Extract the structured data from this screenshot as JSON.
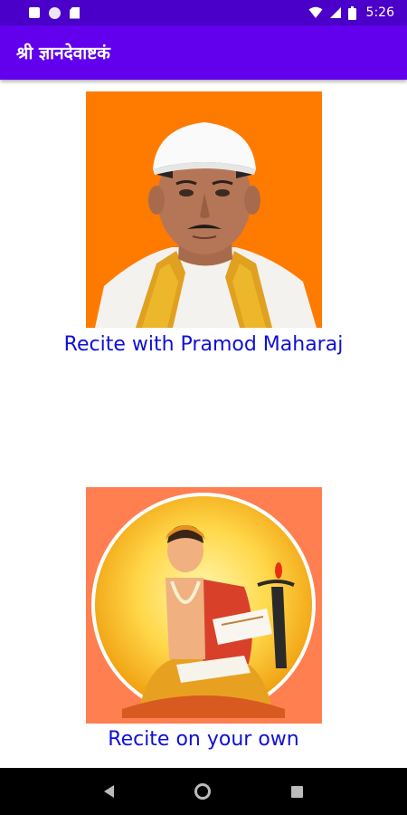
{
  "status_bar": {
    "time": "5:26",
    "icons": [
      "notification-a-icon",
      "notification-circle-icon",
      "sim-card-icon",
      "wifi-icon",
      "signal-icon",
      "battery-icon"
    ]
  },
  "app_bar": {
    "title": "श्री ज्ञानदेवाष्टकं",
    "color": "#6200ee",
    "status_color": "#4a00c8"
  },
  "options": [
    {
      "label": "Recite with Pramod Maharaj",
      "image": "pramod-maharaj-portrait"
    },
    {
      "label": "Recite on your own",
      "image": "sant-dnyaneshwar-painting"
    }
  ],
  "nav_bar": {
    "icons": [
      "back-icon",
      "home-icon",
      "recents-icon"
    ]
  },
  "colors": {
    "label_text": "#1010d8",
    "card1_bg": "#ff7b00",
    "card2_bg": "#ff7f50"
  }
}
